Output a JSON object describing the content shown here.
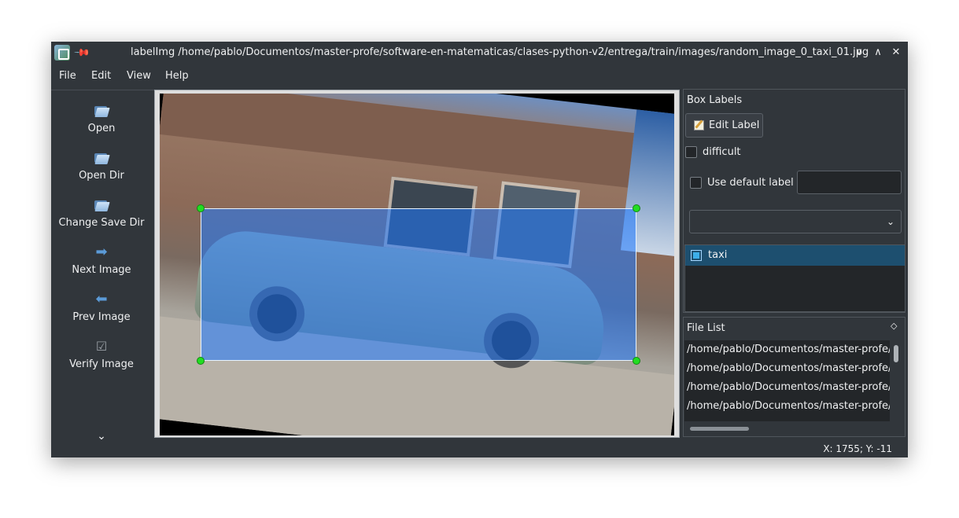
{
  "window": {
    "title": "labelImg /home/pablo/Documentos/master-profe/software-en-matematicas/clases-python-v2/entrega/train/images/random_image_0_taxi_01.jpg"
  },
  "menu": {
    "file": "File",
    "edit": "Edit",
    "view": "View",
    "help": "Help"
  },
  "toolbar": {
    "open": "Open",
    "open_dir": "Open Dir",
    "change_save_dir": "Change Save Dir",
    "next_image": "Next Image",
    "prev_image": "Prev Image",
    "verify_image": "Verify Image"
  },
  "box_labels": {
    "title": "Box Labels",
    "edit_label": "Edit Label",
    "difficult": "difficult",
    "use_default_label": "Use default label",
    "default_label_value": "",
    "combo_value": "",
    "labels": [
      {
        "text": "taxi",
        "checked": true
      }
    ]
  },
  "file_list": {
    "title": "File List",
    "files": [
      "/home/pablo/Documentos/master-profe/s",
      "/home/pablo/Documentos/master-profe/s",
      "/home/pablo/Documentos/master-profe/s",
      "/home/pablo/Documentos/master-profe/s"
    ]
  },
  "status": {
    "coords": "X: 1755; Y: -11"
  },
  "colors": {
    "window_bg": "#31363b",
    "selection": "#1d4f6f",
    "bbox_fill": "#1e78ff",
    "handle": "#22dd22"
  },
  "icons": [
    "app-icon",
    "pin-icon",
    "minimize-icon",
    "maximize-icon",
    "close-icon",
    "folder-open-icon",
    "arrow-right-icon",
    "arrow-left-icon",
    "checkbox-verify-icon",
    "chevron-down-icon",
    "edit-icon",
    "float-icon"
  ]
}
